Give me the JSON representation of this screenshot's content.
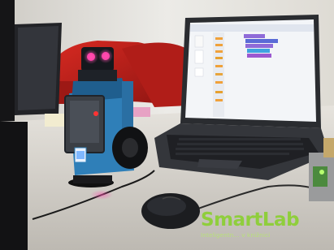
{
  "photo": {
    "subject_icons": {
      "robot": "robot-icon",
      "laptop": "laptop-icon",
      "mouse": "mouse-icon"
    },
    "colors": {
      "wall": "#e9e7e2",
      "chair": "#c2241f",
      "desk": "#d9d6cf",
      "robot_blue": "#2f7fb8",
      "laptop_body": "#2a2c30",
      "screen": "#f3f5f8",
      "logo_green": "#8fce3c"
    }
  },
  "logo": {
    "word_smart": "Smart",
    "word_lab": "Lab",
    "tagline": "Inteligentn... v knižnici"
  }
}
